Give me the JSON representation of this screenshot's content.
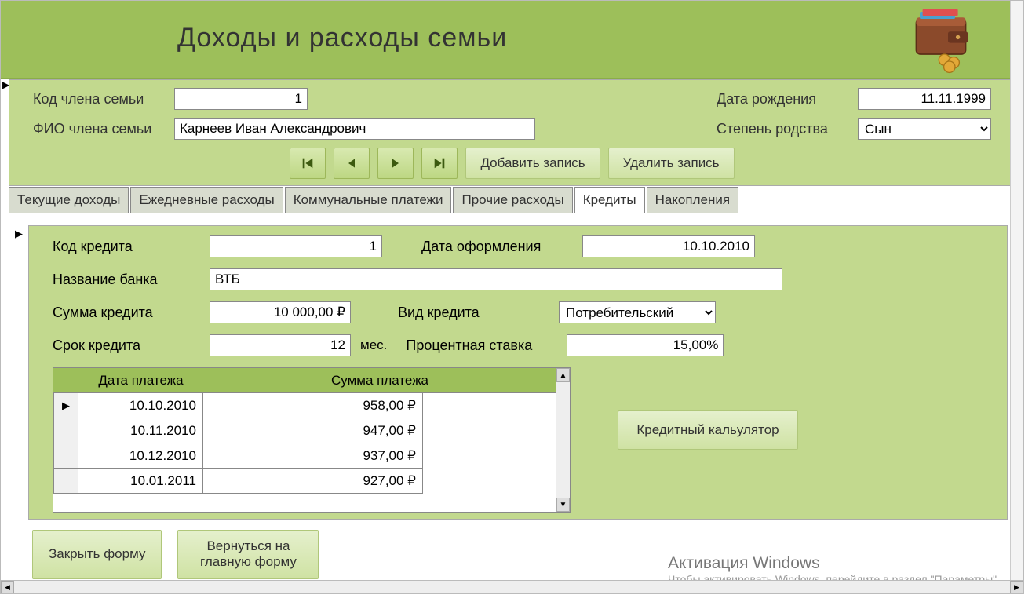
{
  "header": {
    "title": "Доходы и расходы  семьи"
  },
  "member": {
    "code_label": "Код члена семьи",
    "code_value": "1",
    "fio_label": "ФИО члена семьи",
    "fio_value": "Карнеев Иван Александрович",
    "dob_label": "Дата рождения",
    "dob_value": "11.11.1999",
    "rel_label": "Степень родства",
    "rel_value": "Сын"
  },
  "nav": {
    "add": "Добавить запись",
    "del": "Удалить запись"
  },
  "tabs": {
    "t0": "Текущие доходы",
    "t1": "Ежедневные расходы",
    "t2": "Коммунальные платежи",
    "t3": "Прочие расходы",
    "t4": "Кредиты",
    "t5": "Накопления"
  },
  "credit": {
    "code_label": "Код кредита",
    "code_value": "1",
    "date_label": "Дата оформления",
    "date_value": "10.10.2010",
    "bank_label": "Название банка",
    "bank_value": "ВТБ",
    "sum_label": "Сумма кредита",
    "sum_value": "10 000,00 ₽",
    "type_label": "Вид кредита",
    "type_value": "Потребительский",
    "term_label": "Срок кредита",
    "term_value": "12",
    "term_unit": "мес.",
    "rate_label": "Процентная ставка",
    "rate_value": "15,00%"
  },
  "payments": {
    "col1": "Дата платежа",
    "col2": "Сумма платежа",
    "rows": [
      {
        "date": "10.10.2010",
        "sum": "958,00 ₽"
      },
      {
        "date": "10.11.2010",
        "sum": "947,00 ₽"
      },
      {
        "date": "10.12.2010",
        "sum": "937,00 ₽"
      },
      {
        "date": "10.01.2011",
        "sum": "927,00 ₽"
      }
    ]
  },
  "calc_btn": "Кредитный кальулятор",
  "bottom": {
    "close": "Закрыть форму",
    "back": "Вернуться на главную форму"
  },
  "activate": {
    "title": "Активация Windows",
    "sub": "Чтобы активировать Windows, перейдите в раздел \"Параметры\"."
  }
}
